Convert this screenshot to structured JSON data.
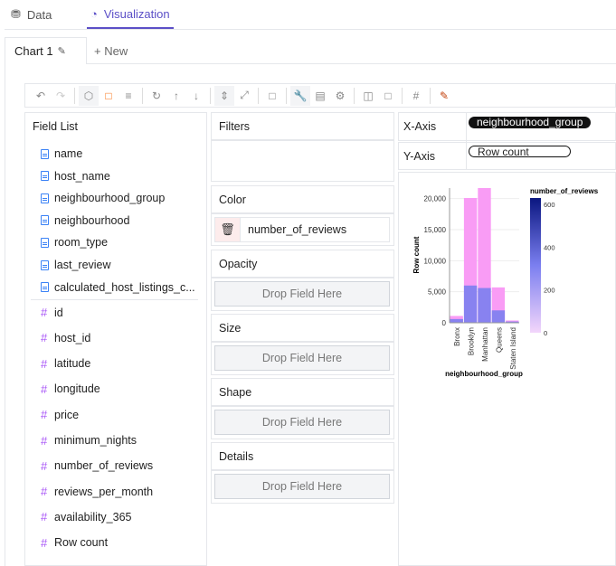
{
  "top_tabs": [
    {
      "label": "Data",
      "icon": "database-icon"
    },
    {
      "label": "Visualization",
      "icon": "pie-chart-icon"
    }
  ],
  "chart_tabs": {
    "active": "Chart 1",
    "new": "+ New"
  },
  "field_list": {
    "title": "Field List",
    "dimensions": [
      "name",
      "host_name",
      "neighbourhood_group",
      "neighbourhood",
      "room_type",
      "last_review",
      "calculated_host_listings_c..."
    ],
    "measures": [
      "id",
      "host_id",
      "latitude",
      "longitude",
      "price",
      "minimum_nights",
      "number_of_reviews",
      "reviews_per_month",
      "availability_365",
      "Row count"
    ]
  },
  "encodings": {
    "filters": "Filters",
    "color": "Color",
    "color_field": "number_of_reviews",
    "opacity": "Opacity",
    "size": "Size",
    "shape": "Shape",
    "details": "Details",
    "drop": "Drop Field Here"
  },
  "axes": {
    "x_label": "X-Axis",
    "x_field": "neighbourhood_group",
    "y_label": "Y-Axis",
    "y_field": "Row count"
  },
  "colors": {
    "accent": "#5b4fc7",
    "pink": "#f99cf5",
    "blue": "#7b7ff0"
  },
  "chart_data": {
    "type": "bar",
    "stacked": true,
    "categories": [
      "Bronx",
      "Brooklyn",
      "Manhattan",
      "Queens",
      "Staten Island"
    ],
    "values": [
      1100,
      20100,
      21700,
      5700,
      370
    ],
    "high_reviews_portion": [
      600,
      6000,
      5600,
      2000,
      200
    ],
    "xlabel": "neighbourhood_group",
    "ylabel": "Row count",
    "ylim": [
      0,
      21700
    ],
    "yticks": [
      "0",
      "5,000",
      "10,000",
      "15,000",
      "20,000"
    ],
    "ytick_values": [
      0,
      5000,
      10000,
      15000,
      20000
    ],
    "legend": {
      "title": "number_of_reviews",
      "ticks": [
        "0",
        "200",
        "400",
        "600"
      ],
      "tick_values": [
        0,
        200,
        400,
        600
      ],
      "range": [
        0,
        630
      ],
      "placement": "right"
    }
  }
}
